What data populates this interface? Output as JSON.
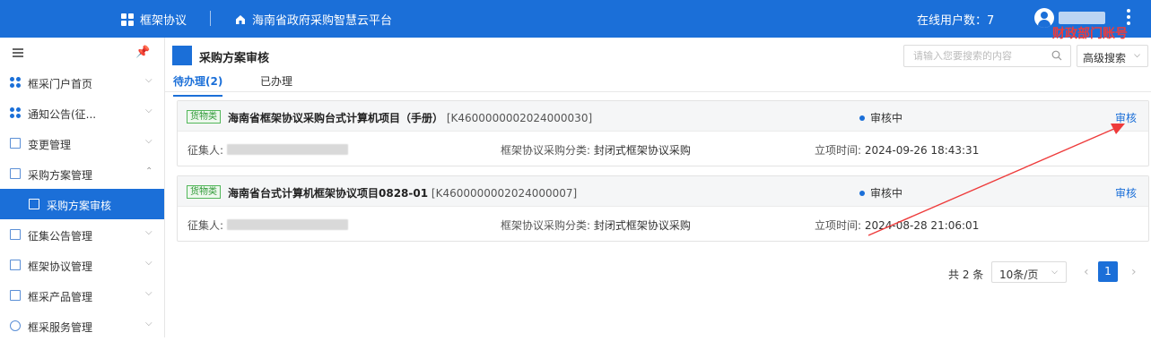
{
  "topbar": {
    "app_name": "框架协议",
    "platform_name": "海南省政府采购智慧云平台",
    "online_users_label": "在线用户数：7",
    "account_label": "财政部门账号"
  },
  "sidebar": {
    "items": [
      {
        "label": "框采门户首页",
        "icon": "dots-icon",
        "chevron": "⌵"
      },
      {
        "label": "通知公告(征...",
        "icon": "dots-icon",
        "chevron": "⌵"
      },
      {
        "label": "变更管理",
        "icon": "change-icon",
        "chevron": "⌵"
      },
      {
        "label": "采购方案管理",
        "icon": "doc-icon",
        "chevron": "⌃"
      },
      {
        "label": "采购方案审核",
        "icon": "doc-icon"
      },
      {
        "label": "征集公告管理",
        "icon": "folder-icon",
        "chevron": "⌵"
      },
      {
        "label": "框架协议管理",
        "icon": "contract-icon",
        "chevron": "⌵"
      },
      {
        "label": "框采产品管理",
        "icon": "product-icon",
        "chevron": "⌵"
      },
      {
        "label": "框采服务管理",
        "icon": "service-icon",
        "chevron": "⌵"
      }
    ]
  },
  "page": {
    "title": "采购方案审核",
    "search_placeholder": "请输入您要搜索的内容",
    "advanced_search": "高级搜索",
    "tabs": [
      "待办理(2)",
      "已办理"
    ]
  },
  "cards": [
    {
      "tag": "货物类",
      "title": "海南省框架协议采购台式计算机项目（手册）",
      "code": "[K4600000002024000030]",
      "status": "审核中",
      "action": "审核",
      "solicitor_label": "征集人:",
      "category_label": "框架协议采购分类:",
      "category_value": "封闭式框架协议采购",
      "time_label": "立项时间:",
      "time_value": "2024-09-26 18:43:31"
    },
    {
      "tag": "货物类",
      "title": "海南省台式计算机框架协议项目0828-01",
      "code": "[K4600000002024000007]",
      "status": "审核中",
      "action": "审核",
      "solicitor_label": "征集人:",
      "category_label": "框架协议采购分类:",
      "category_value": "封闭式框架协议采购",
      "time_label": "立项时间:",
      "time_value": "2024-08-28 21:06:01"
    }
  ],
  "pagination": {
    "total": "共 2 条",
    "page_size": "10条/页",
    "current_page": "1"
  },
  "colors": {
    "brand": "#1b6fd8",
    "tag_green": "#2f9a37",
    "annotation_red": "#ee3b3b"
  }
}
